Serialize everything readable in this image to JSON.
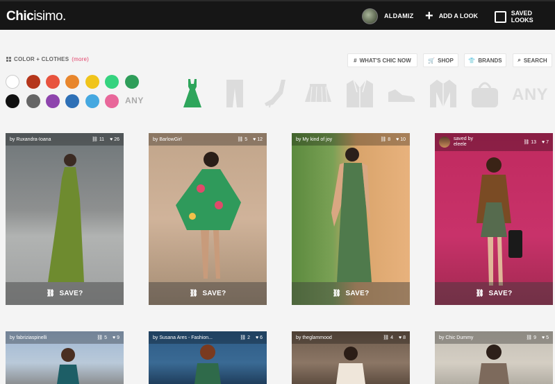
{
  "header": {
    "logo_bold": "Chic",
    "logo_light": "isimo.",
    "username": "ALDAMIZ",
    "add_look_label": "ADD A LOOK",
    "saved_looks_label": "SAVED LOOKS"
  },
  "filter": {
    "title": "COLOR + CLOTHES",
    "more": "(more)",
    "any_color": "ANY",
    "any_clothes": "ANY",
    "colors": [
      "#ffffff",
      "#b5361b",
      "#e8533e",
      "#e8862c",
      "#f0c41b",
      "#35d37f",
      "#2e9d59",
      "#111111",
      "#666666",
      "#8e44ad",
      "#2e70b6",
      "#45a8e0",
      "#e8679a"
    ],
    "clothes": [
      "dress-icon",
      "pants-icon",
      "heel-icon",
      "skirt-icon",
      "suit-icon",
      "sneaker-icon",
      "jacket-icon",
      "bag-icon"
    ]
  },
  "nav": {
    "whats_chic": "WHAT'S CHIC NOW",
    "shop": "SHOP",
    "brands": "BRANDS",
    "search": "SEARCH"
  },
  "cards": [
    {
      "by": "by Ruxandra-Ioana",
      "links": "11",
      "likes": "26",
      "save": "SAVE?"
    },
    {
      "by": "by BarlowGirl",
      "links": "5",
      "likes": "12",
      "save": "SAVE?"
    },
    {
      "by": "by My kind of joy",
      "links": "8",
      "likes": "10",
      "save": "SAVE?"
    },
    {
      "by_line1": "saved by",
      "by_line2": "eleele",
      "links": "13",
      "likes": "7",
      "save": "SAVE?"
    },
    {
      "by": "by fabriziaspinelli",
      "links": "5",
      "likes": "9"
    },
    {
      "by": "by Susana Ares - Fashion...",
      "links": "2",
      "likes": "6"
    },
    {
      "by": "by theglammood",
      "links": "4",
      "likes": "8"
    },
    {
      "by": "by Chic Dummy",
      "links": "9",
      "likes": "5"
    }
  ]
}
